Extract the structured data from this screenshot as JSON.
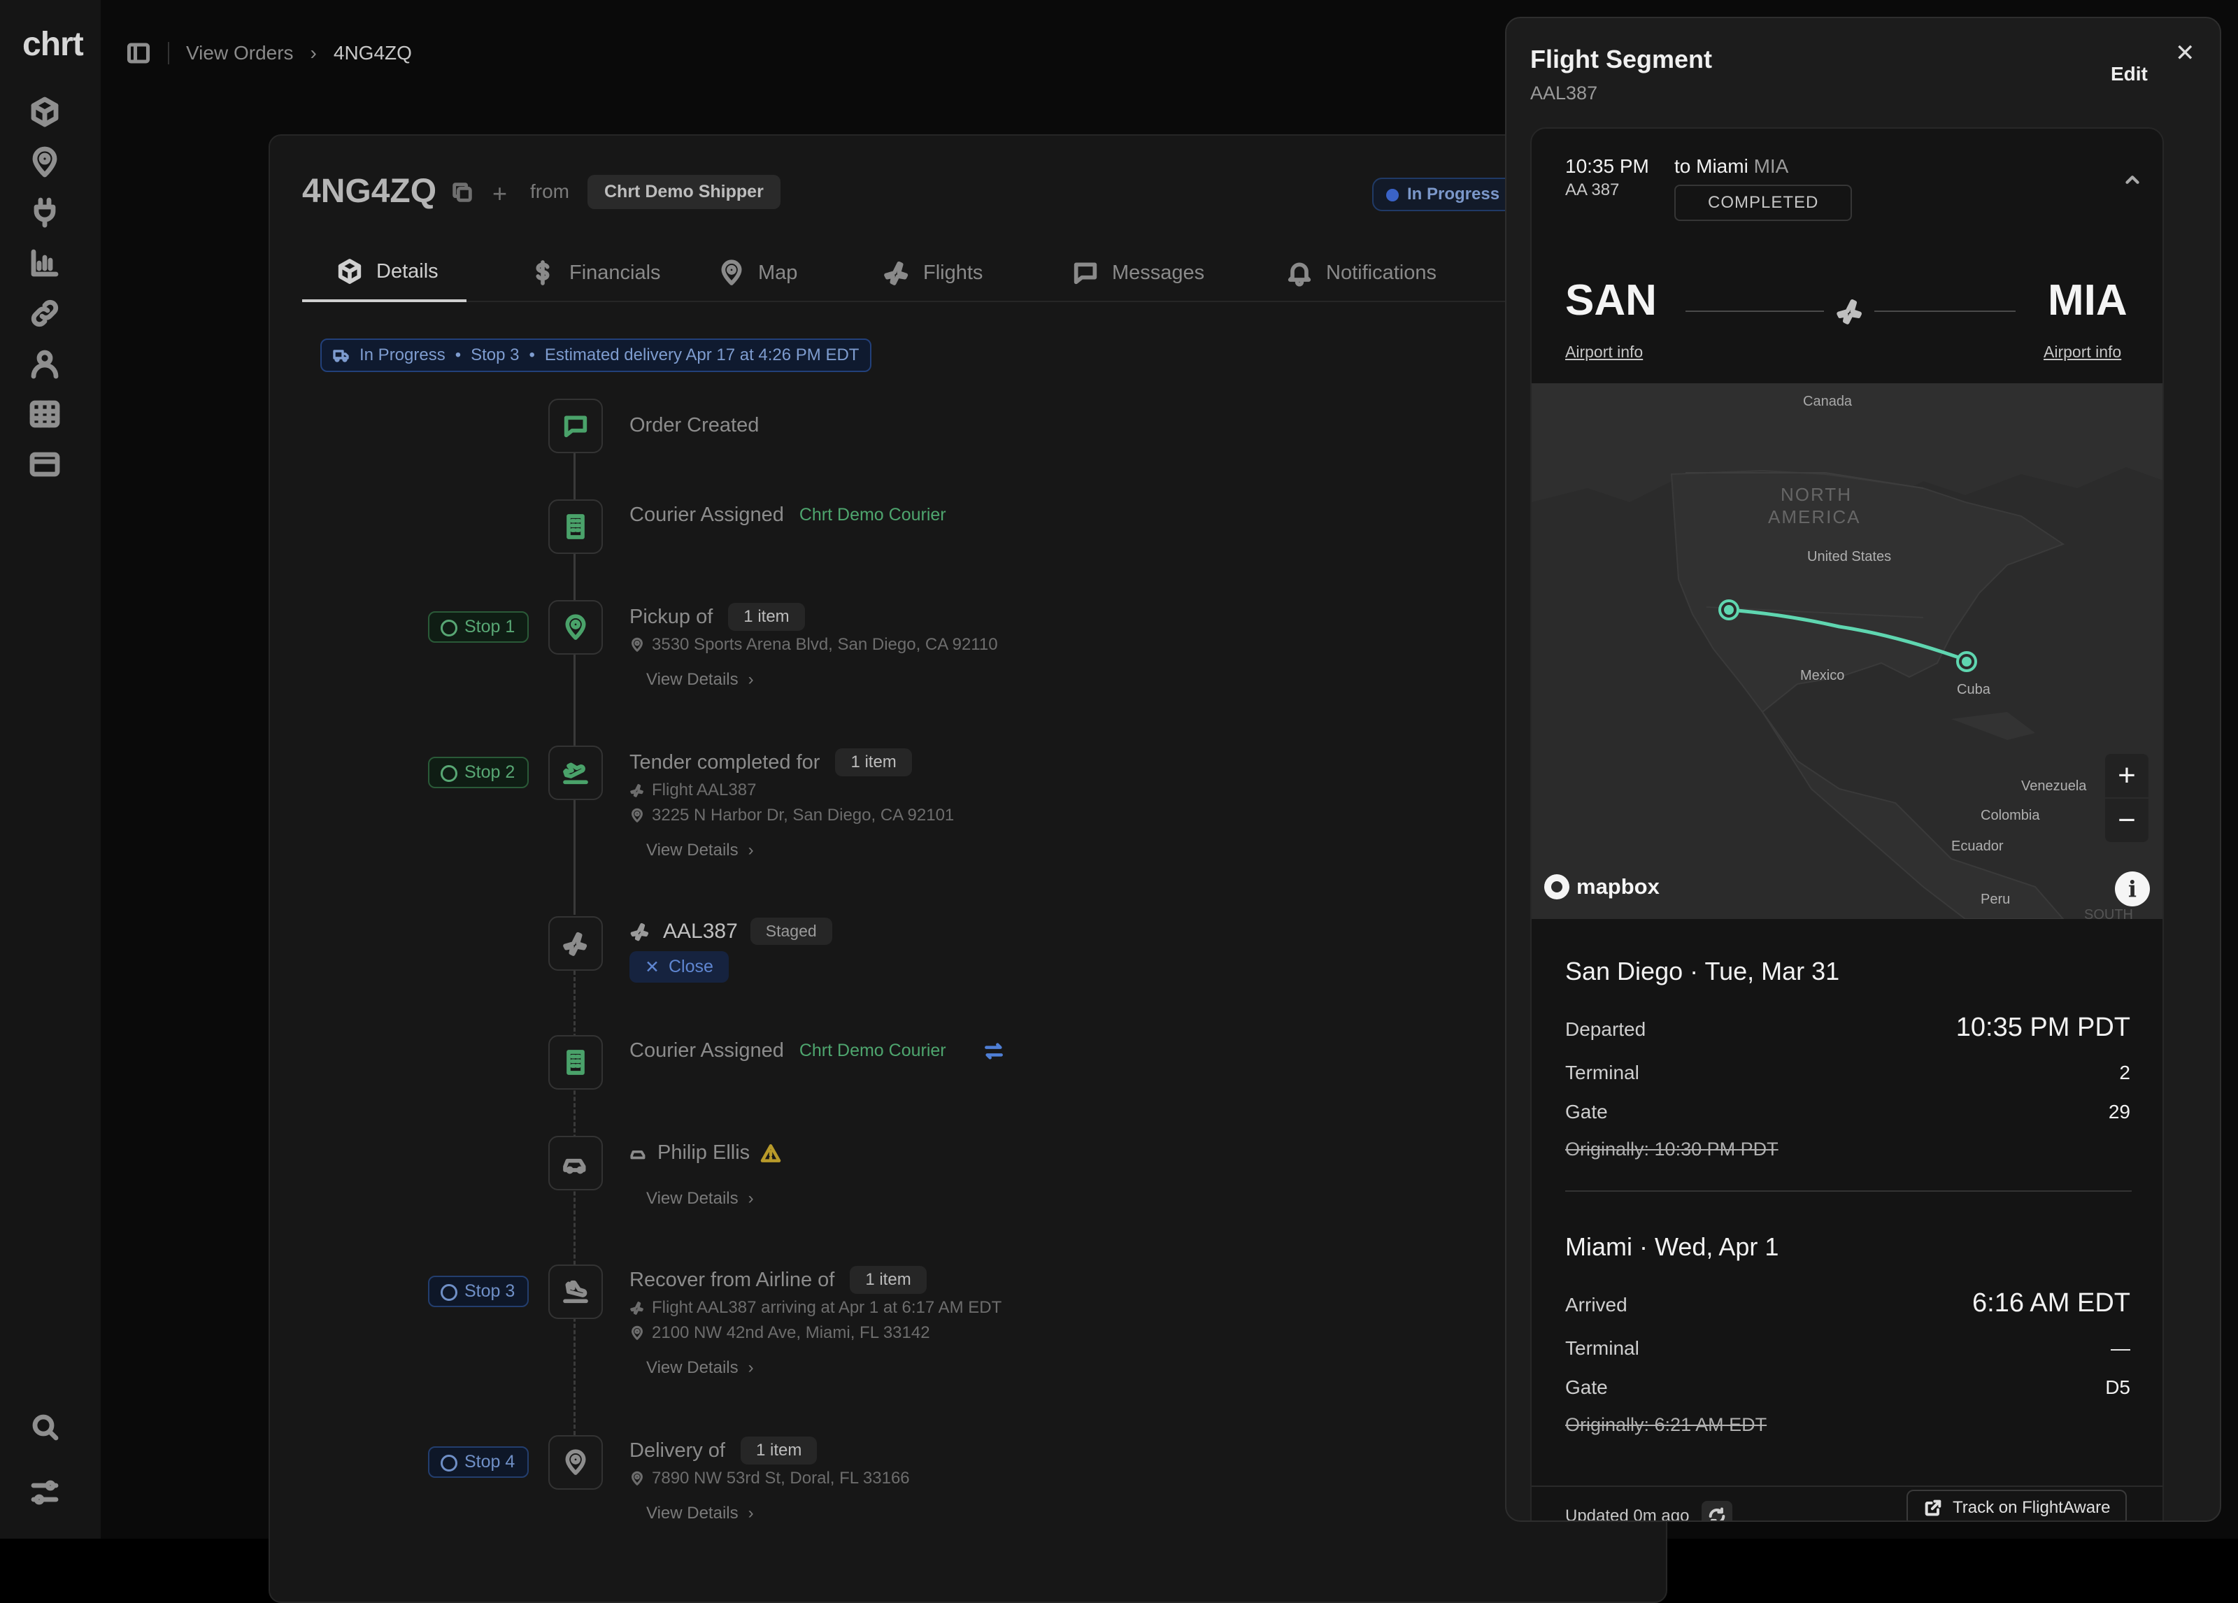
{
  "app": {
    "logo": "chrt"
  },
  "breadcrumb": {
    "parent": "View Orders",
    "sep": "›",
    "current": "4NG4ZQ"
  },
  "order": {
    "id": "4NG4ZQ",
    "from_label": "from",
    "shipper": "Chrt Demo Shipper",
    "status": "In Progress",
    "banner": {
      "status": "In Progress",
      "stop": "Stop 3",
      "eta": "Estimated delivery Apr 17 at 4:26 PM EDT",
      "bullet": "•"
    }
  },
  "tabs": [
    {
      "label": "Details",
      "icon": "box-icon"
    },
    {
      "label": "Financials",
      "icon": "dollar-icon"
    },
    {
      "label": "Map",
      "icon": "pin-icon"
    },
    {
      "label": "Flights",
      "icon": "plane-icon"
    },
    {
      "label": "Messages",
      "icon": "message-icon"
    },
    {
      "label": "Notifications",
      "icon": "bell-icon"
    }
  ],
  "timeline": {
    "order_created": "Order Created",
    "courier_assigned_1": {
      "label": "Courier Assigned",
      "courier": "Chrt Demo Courier"
    },
    "stop1": {
      "badge": "Stop 1",
      "label": "Pickup of",
      "items": "1 item",
      "address": "3530 Sports Arena Blvd, San Diego, CA 92110",
      "view": "View Details"
    },
    "stop2": {
      "badge": "Stop 2",
      "label": "Tender completed for",
      "items": "1 item",
      "flight": "Flight AAL387",
      "address": "3225 N Harbor Dr, San Diego, CA 92101",
      "view": "View Details"
    },
    "flight": {
      "code": "AAL387",
      "state": "Staged",
      "close": "Close"
    },
    "courier_assigned_2": {
      "label": "Courier Assigned",
      "courier": "Chrt Demo Courier"
    },
    "driver": {
      "name": "Philip Ellis",
      "view": "View Details"
    },
    "stop3": {
      "badge": "Stop 3",
      "label": "Recover from Airline of",
      "items": "1 item",
      "flight": "Flight AAL387 arriving at Apr 1 at 6:17 AM EDT",
      "address": "2100 NW 42nd Ave, Miami, FL 33142",
      "view": "View Details"
    },
    "stop4": {
      "badge": "Stop 4",
      "label": "Delivery of",
      "items": "1 item",
      "address": "7890 NW 53rd St, Doral, FL 33166",
      "view": "View Details"
    }
  },
  "panel": {
    "title": "Flight Segment",
    "subtitle": "AAL387",
    "edit": "Edit",
    "close": "✕",
    "flight": {
      "time": "10:35 PM",
      "code": "AA 387",
      "to_prefix": "to Miami",
      "to_code": "MIA",
      "status": "COMPLETED",
      "origin": "SAN",
      "destination": "MIA",
      "airport_info": "Airport info"
    },
    "map": {
      "labels": [
        "Canada",
        "NORTH",
        "AMERICA",
        "United States",
        "Mexico",
        "Cuba",
        "Venezuela",
        "Colombia",
        "Ecuador",
        "Peru",
        "SOUTH"
      ],
      "brand": "mapbox",
      "zoom_in": "+",
      "zoom_out": "−",
      "info": "i",
      "route_color": "#5fd6b0"
    },
    "departure": {
      "city": "San Diego · Tue, Mar 31",
      "label": "Departed",
      "time": "10:35 PM PDT",
      "terminal_label": "Terminal",
      "terminal": "2",
      "gate_label": "Gate",
      "gate": "29",
      "original": "Originally: 10:30 PM PDT"
    },
    "arrival": {
      "city": "Miami · Wed, Apr 1",
      "label": "Arrived",
      "time": "6:16 AM EDT",
      "terminal_label": "Terminal",
      "terminal": "—",
      "gate_label": "Gate",
      "gate": "D5",
      "original": "Originally: 6:21 AM EDT"
    },
    "updated": "Updated 0m ago",
    "track": "Track on FlightAware"
  },
  "colors": {
    "accent_green": "#4ea56e",
    "accent_blue": "#3a63c8",
    "route": "#5fd6b0"
  }
}
